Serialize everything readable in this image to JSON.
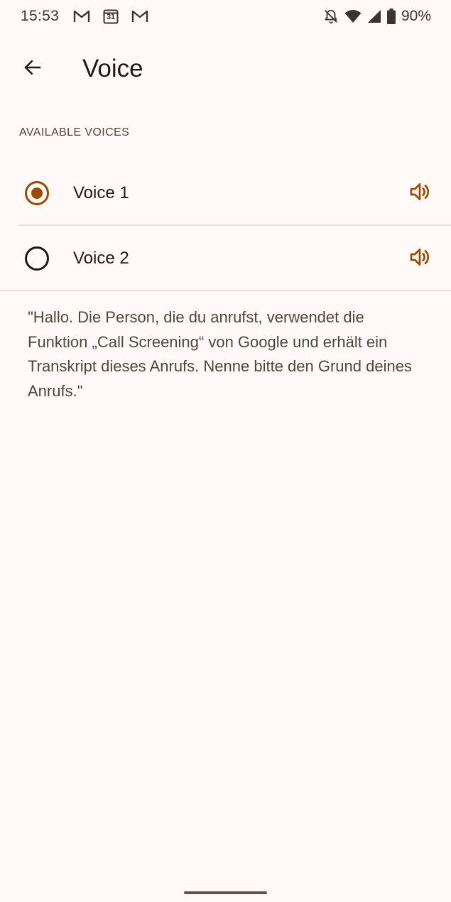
{
  "status_bar": {
    "time": "15:53",
    "notification_icons": [
      "gmail-icon",
      "calendar-icon",
      "gmail-icon"
    ],
    "calendar_day": "31",
    "battery": "90%"
  },
  "app_bar": {
    "back_icon": "arrow-back-icon",
    "title": "Voice"
  },
  "section": {
    "header": "AVAILABLE VOICES"
  },
  "voices": [
    {
      "label": "Voice 1",
      "selected": true
    },
    {
      "label": "Voice 2",
      "selected": false
    }
  ],
  "greeting_text": "\"Hallo. Die Person, die du anrufst, verwendet die Funktion „Call Screening“ von Google und erhält ein Transkript dieses Anrufs. Nenne bitte den Grund deines Anrufs.\"",
  "colors": {
    "accent": "#9c4a00",
    "background": "#fffaf8",
    "text_primary": "#201a17",
    "text_secondary": "#52443c"
  }
}
